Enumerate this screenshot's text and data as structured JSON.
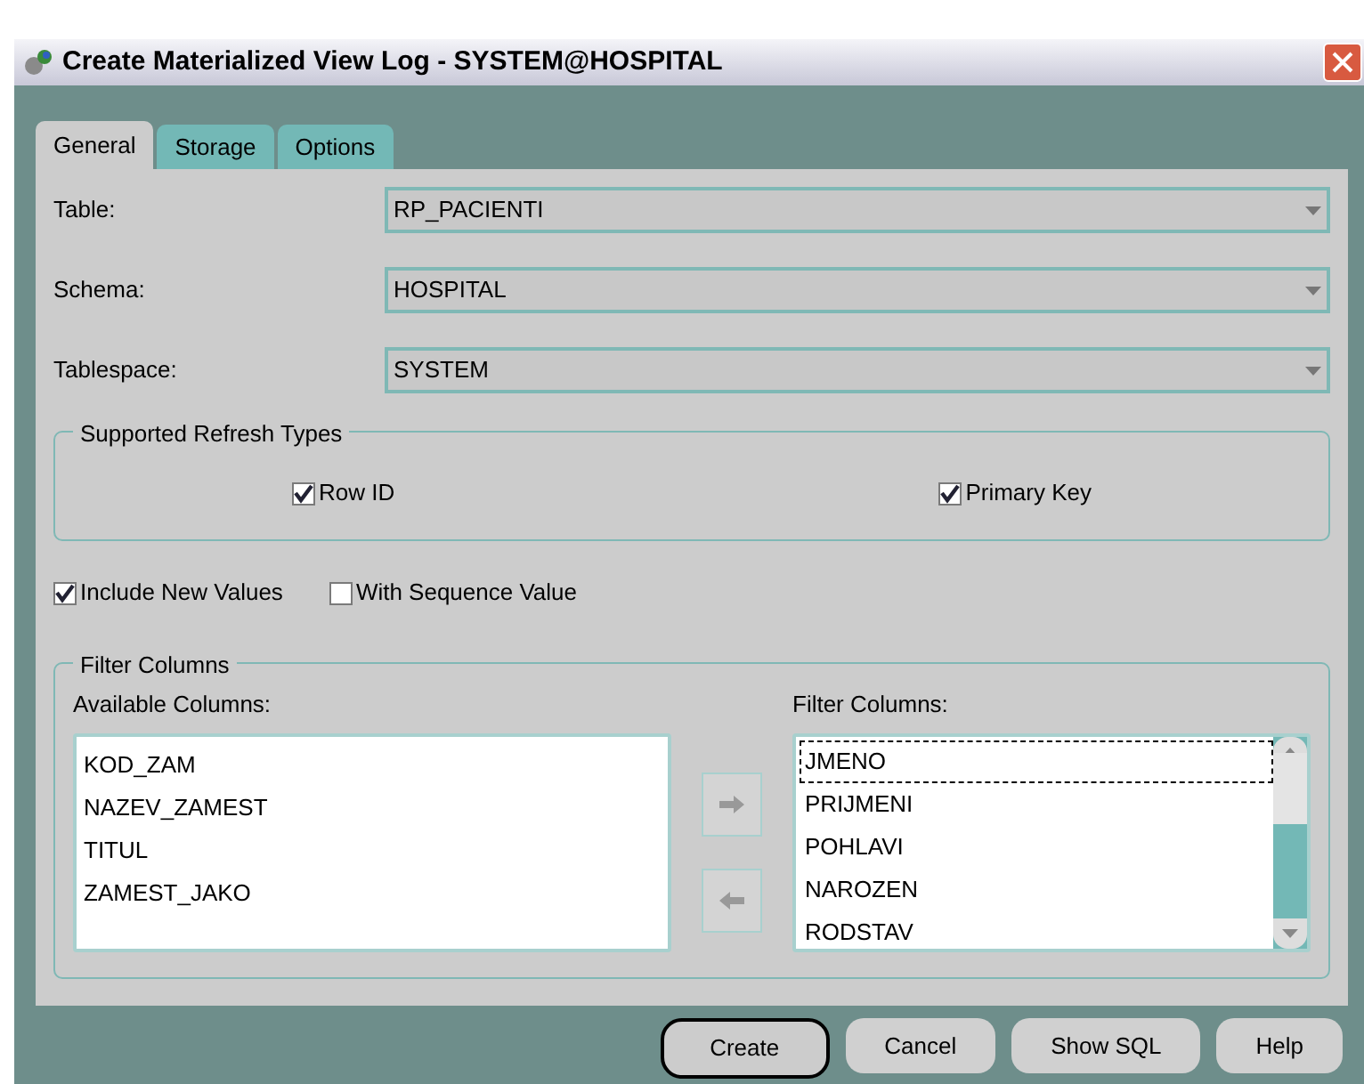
{
  "window": {
    "title": "Create Materialized View Log - SYSTEM@HOSPITAL"
  },
  "tabs": [
    {
      "label": "General",
      "selected": true
    },
    {
      "label": "Storage",
      "selected": false
    },
    {
      "label": "Options",
      "selected": false
    }
  ],
  "fields": [
    {
      "label": "Table:",
      "value": "RP_PACIENTI"
    },
    {
      "label": "Schema:",
      "value": "HOSPITAL"
    },
    {
      "label": "Tablespace:",
      "value": "SYSTEM"
    }
  ],
  "refresh_types": {
    "title": "Supported Refresh Types",
    "options": [
      {
        "label": "Row ID",
        "checked": true
      },
      {
        "label": "Primary Key",
        "checked": true
      }
    ]
  },
  "options": [
    {
      "label": "Include New Values",
      "checked": true
    },
    {
      "label": "With Sequence Value",
      "checked": false
    }
  ],
  "filter_columns": {
    "title": "Filter Columns",
    "available_label": "Available Columns:",
    "available": [
      {
        "label": "KOD_ZAM"
      },
      {
        "label": "NAZEV_ZAMEST"
      },
      {
        "label": "TITUL"
      },
      {
        "label": "ZAMEST_JAKO"
      }
    ],
    "selected_label": "Filter Columns:",
    "selected": [
      {
        "label": "JMENO",
        "focused": true
      },
      {
        "label": "PRIJMENI",
        "focused": false
      },
      {
        "label": "POHLAVI",
        "focused": false
      },
      {
        "label": "NAROZEN",
        "focused": false
      },
      {
        "label": "RODSTAV",
        "focused": false
      }
    ]
  },
  "buttons": [
    {
      "label": "Create",
      "default": true
    },
    {
      "label": "Cancel",
      "default": false
    },
    {
      "label": "Show SQL",
      "default": false
    },
    {
      "label": "Help",
      "default": false
    }
  ]
}
